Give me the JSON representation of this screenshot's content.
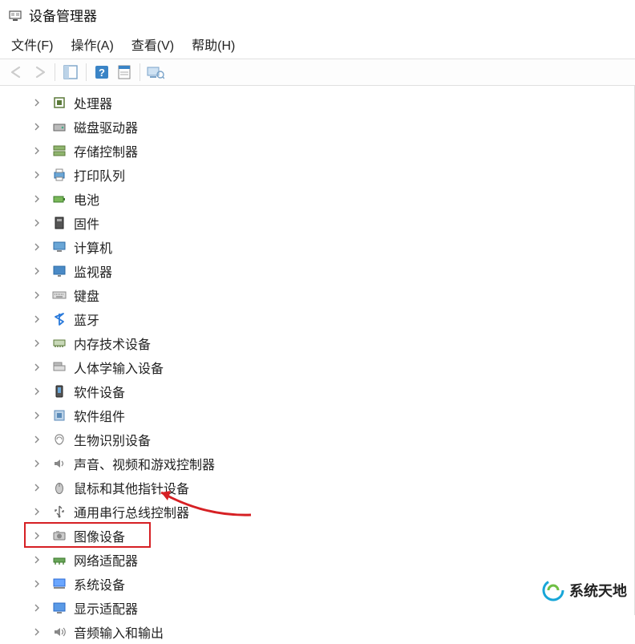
{
  "window": {
    "title": "设备管理器"
  },
  "menubar": {
    "file": "文件(F)",
    "action": "操作(A)",
    "view": "查看(V)",
    "help": "帮助(H)"
  },
  "toolbar": {
    "back": "后退",
    "forward": "前进",
    "details": "显示/隐藏控制台树",
    "help": "帮助",
    "props": "属性",
    "scan": "扫描硬件更改"
  },
  "tree": [
    {
      "icon": "cpu",
      "label": "处理器"
    },
    {
      "icon": "disk",
      "label": "磁盘驱动器"
    },
    {
      "icon": "storage",
      "label": "存储控制器"
    },
    {
      "icon": "printer",
      "label": "打印队列"
    },
    {
      "icon": "battery",
      "label": "电池"
    },
    {
      "icon": "firmware",
      "label": "固件"
    },
    {
      "icon": "computer",
      "label": "计算机"
    },
    {
      "icon": "monitor",
      "label": "监视器"
    },
    {
      "icon": "keyboard",
      "label": "键盘"
    },
    {
      "icon": "bluetooth",
      "label": "蓝牙"
    },
    {
      "icon": "memory",
      "label": "内存技术设备"
    },
    {
      "icon": "hid",
      "label": "人体学输入设备"
    },
    {
      "icon": "softdev",
      "label": "软件设备"
    },
    {
      "icon": "softcomp",
      "label": "软件组件"
    },
    {
      "icon": "biometric",
      "label": "生物识别设备"
    },
    {
      "icon": "sound",
      "label": "声音、视频和游戏控制器"
    },
    {
      "icon": "mouse",
      "label": "鼠标和其他指针设备"
    },
    {
      "icon": "usb",
      "label": "通用串行总线控制器"
    },
    {
      "icon": "imaging",
      "label": "图像设备",
      "highlight": true
    },
    {
      "icon": "network",
      "label": "网络适配器"
    },
    {
      "icon": "system",
      "label": "系统设备"
    },
    {
      "icon": "display",
      "label": "显示适配器"
    },
    {
      "icon": "audio",
      "label": "音频输入和输出"
    }
  ],
  "watermark": {
    "text": "系统天地"
  }
}
